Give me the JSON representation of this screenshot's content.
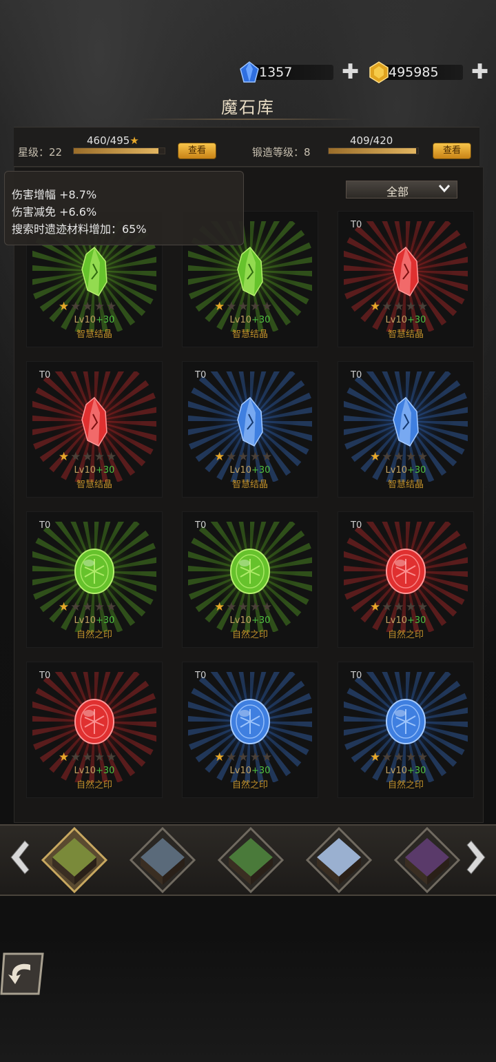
{
  "currency": {
    "diamonds": "1357",
    "gold": "495985"
  },
  "title": "魔石库",
  "star_level": {
    "label": "星级：22",
    "progress_text": "460/495",
    "progress_fraction": 0.929,
    "button": "查看"
  },
  "forge_level": {
    "label": "锻造等级：8",
    "progress_text": "409/420",
    "progress_fraction": 0.974,
    "button": "查看"
  },
  "filter": {
    "selected": "全部"
  },
  "tooltip": {
    "lines": [
      "伤害增幅 +8.7%",
      "伤害减免 +6.6%",
      "搜索时遗迹材料增加：65%"
    ]
  },
  "colors": {
    "green": "#5fc02a",
    "red": "#e03030",
    "blue": "#3f7fe0",
    "gold_star": "#e8a82a"
  },
  "items": [
    {
      "tier": "",
      "color": "green",
      "shape": "crystal",
      "stars": 1,
      "level": "Lv10",
      "bonus": "+30",
      "name": "智慧结晶"
    },
    {
      "tier": "",
      "color": "green",
      "shape": "crystal",
      "stars": 1,
      "level": "Lv10",
      "bonus": "+30",
      "name": "智慧结晶"
    },
    {
      "tier": "T0",
      "color": "red",
      "shape": "crystal",
      "stars": 1,
      "level": "Lv10",
      "bonus": "+30",
      "name": "智慧结晶"
    },
    {
      "tier": "T0",
      "color": "red",
      "shape": "crystal",
      "stars": 1,
      "level": "Lv10",
      "bonus": "+30",
      "name": "智慧结晶"
    },
    {
      "tier": "T0",
      "color": "blue",
      "shape": "crystal",
      "stars": 1,
      "level": "Lv10",
      "bonus": "+30",
      "name": "智慧结晶"
    },
    {
      "tier": "T0",
      "color": "blue",
      "shape": "crystal",
      "stars": 1,
      "level": "Lv10",
      "bonus": "+30",
      "name": "智慧结晶"
    },
    {
      "tier": "T0",
      "color": "green",
      "shape": "seal",
      "stars": 1,
      "level": "Lv10",
      "bonus": "+30",
      "name": "自然之印"
    },
    {
      "tier": "T0",
      "color": "green",
      "shape": "seal",
      "stars": 1,
      "level": "Lv10",
      "bonus": "+30",
      "name": "自然之印"
    },
    {
      "tier": "T0",
      "color": "red",
      "shape": "seal",
      "stars": 1,
      "level": "Lv10",
      "bonus": "+30",
      "name": "自然之印"
    },
    {
      "tier": "T0",
      "color": "red",
      "shape": "seal",
      "stars": 1,
      "level": "Lv10",
      "bonus": "+30",
      "name": "自然之印"
    },
    {
      "tier": "T0",
      "color": "blue",
      "shape": "seal",
      "stars": 1,
      "level": "Lv10",
      "bonus": "+30",
      "name": "自然之印"
    },
    {
      "tier": "T0",
      "color": "blue",
      "shape": "seal",
      "stars": 1,
      "level": "Lv10",
      "bonus": "+30",
      "name": "自然之印"
    }
  ],
  "regions": [
    {
      "icon": "swamp-region-icon",
      "color": "#7a8a3a",
      "selected": true
    },
    {
      "icon": "town-region-icon",
      "color": "#5a6a7a",
      "selected": false
    },
    {
      "icon": "forest-region-icon",
      "color": "#4a7a3a",
      "selected": false
    },
    {
      "icon": "snow-region-icon",
      "color": "#9ab0d0",
      "selected": false
    },
    {
      "icon": "dark-region-icon",
      "color": "#5a3a6a",
      "selected": false
    }
  ]
}
